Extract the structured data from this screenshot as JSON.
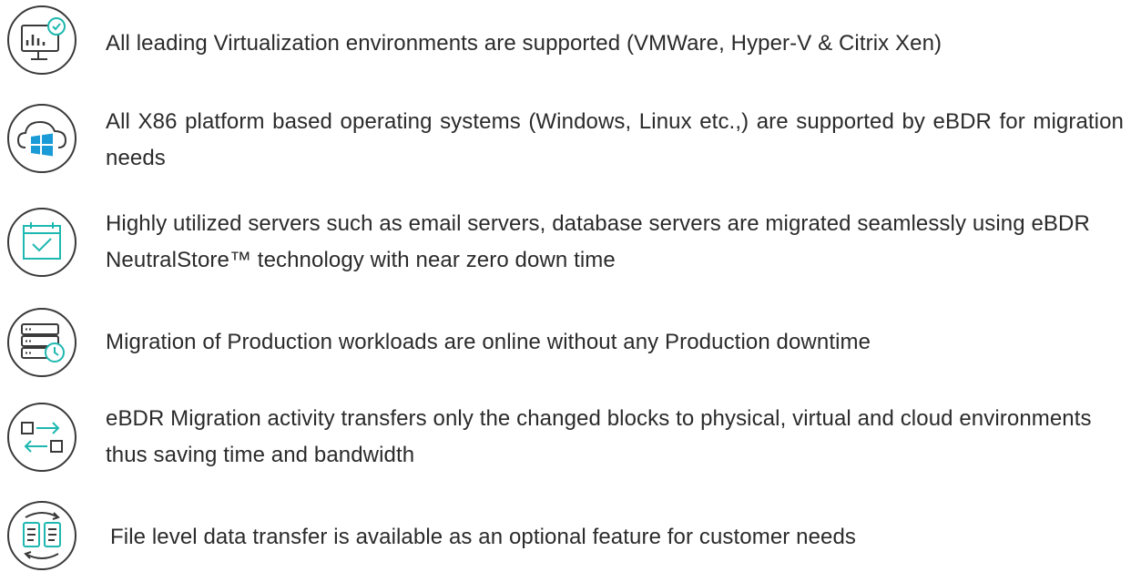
{
  "features": [
    {
      "icon": "monitor-chart-check-icon",
      "text": "All leading Virtualization environments are supported (VMWare, Hyper-V & Citrix Xen)"
    },
    {
      "icon": "cloud-windows-icon",
      "text": "All X86 platform based operating systems (Windows, Linux etc.,) are supported by eBDR for migration needs"
    },
    {
      "icon": "calendar-check-icon",
      "text": "Highly utilized servers such as email servers, database servers are migrated seamlessly using eBDR NeutralStore™ technology with near zero down time"
    },
    {
      "icon": "server-clock-icon",
      "text": "Migration of Production workloads are online without any Production downtime"
    },
    {
      "icon": "transfer-arrows-icon",
      "text": "eBDR Migration activity transfers only the changed blocks to physical, virtual and cloud environments thus saving time and bandwidth"
    },
    {
      "icon": "file-sync-icon",
      "text": "File level data transfer is available as an optional feature for customer needs"
    }
  ],
  "colors": {
    "icon_stroke": "#3a3a3a",
    "accent_teal": "#1eb8b0",
    "windows_blue": "#1a9bd7",
    "text": "#2b2b2b"
  }
}
